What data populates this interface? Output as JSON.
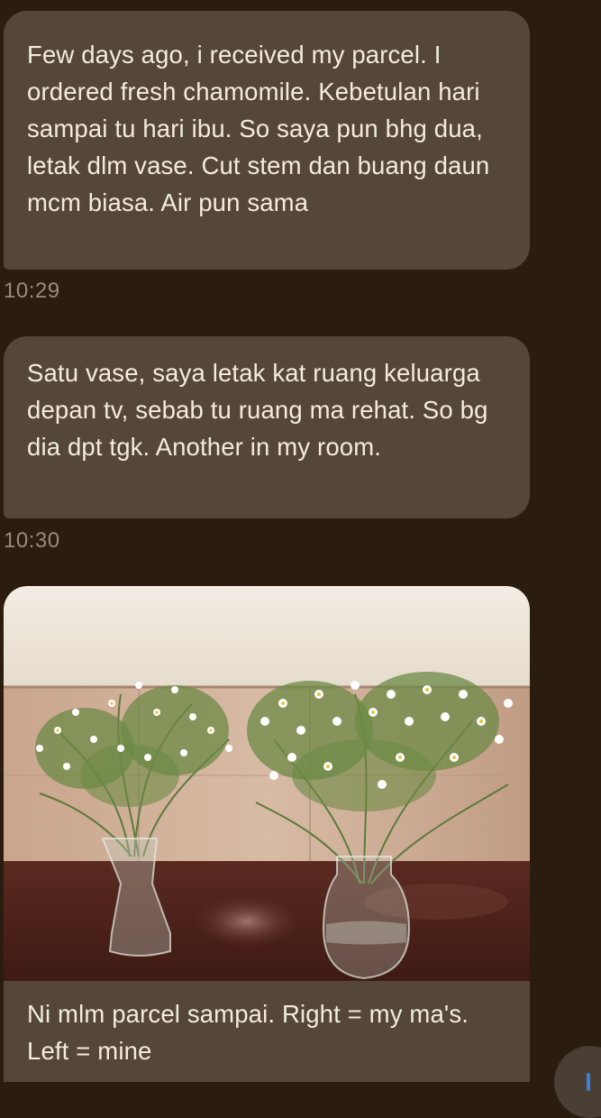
{
  "messages": [
    {
      "text": "Few days ago, i received my parcel. I ordered fresh chamomile. Kebetulan hari sampai tu hari ibu. So saya pun bhg dua, letak dlm vase. Cut stem dan buang daun mcm biasa. Air pun sama",
      "time": "10:29"
    },
    {
      "text": "Satu vase, saya letak kat ruang keluarga depan tv, sebab tu ruang ma rehat. So bg dia dpt tgk. Another in my room.",
      "time": "10:30"
    },
    {
      "caption": "Ni mlm parcel sampai. Right = my ma's. Left = mine",
      "photo_subject": "two glass vases of chamomile flowers on a table"
    }
  ],
  "colors": {
    "background": "#2a1d0f",
    "bubble": "#54473a",
    "text": "#f3ebde",
    "timestamp": "#9a8a7a",
    "accent": "#3e7fd6"
  },
  "icons": {
    "compose": "compose-icon"
  }
}
